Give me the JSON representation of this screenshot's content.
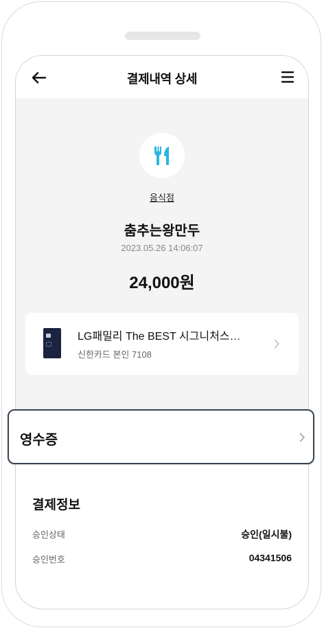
{
  "header": {
    "title": "결제내역 상세",
    "back_icon": "arrow-left-icon",
    "menu_icon": "hamburger-menu-icon"
  },
  "transaction": {
    "category_icon": "fork-knife-icon",
    "category": "음식점",
    "merchant": "춤추는왕만두",
    "datetime": "2023.05.26 14:06:07",
    "amount": "24,000원"
  },
  "card": {
    "name": "LG패밀리 The BEST 시그니처스…",
    "sub": "신한카드 본인 7108"
  },
  "receipt": {
    "label": "영수증"
  },
  "payment_info": {
    "title": "결제정보",
    "rows": [
      {
        "label": "승인상태",
        "value": "승인(일시불)"
      },
      {
        "label": "승인번호",
        "value": "04341506"
      }
    ]
  },
  "colors": {
    "accent": "#2bb5e0",
    "background_grey": "#f4f4f4",
    "card_navy": "#1b2340"
  }
}
